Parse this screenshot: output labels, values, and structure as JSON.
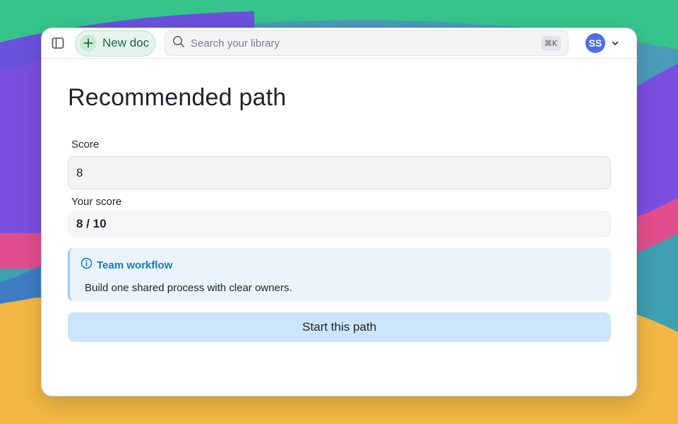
{
  "colors": {
    "accent_green": "#176b3a",
    "avatar_bg": "#4f6ee8",
    "callout_bg": "#eaf4fd",
    "callout_title": "#1679c8",
    "primary_button_bg": "#cde5fb"
  },
  "topbar": {
    "sidebar_toggle_icon": "sidebar-panel-icon",
    "new_doc_label": "New doc",
    "search_placeholder": "Search your library",
    "search_shortcut": "⌘K",
    "avatar_initials": "SS"
  },
  "main": {
    "title": "Recommended path",
    "score_label": "Score",
    "score_value": "8",
    "your_score_label": "Your score",
    "your_score_value": "8 / 10",
    "callout": {
      "icon": "info-icon",
      "title": "Team workflow",
      "body": "Build one shared process with clear owners."
    },
    "start_button_label": "Start this path"
  }
}
